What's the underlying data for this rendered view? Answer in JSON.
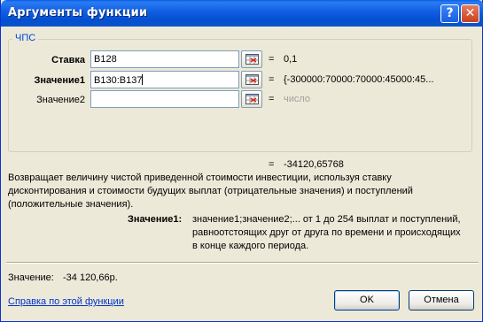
{
  "window": {
    "title": "Аргументы функции"
  },
  "titlebar_buttons": {
    "help": "?",
    "close": "✕"
  },
  "group": {
    "label": "ЧПС"
  },
  "args": [
    {
      "label": "Ставка",
      "value": "B128",
      "result": "0,1"
    },
    {
      "label": "Значение1",
      "value": "B130:B137",
      "result": "{-300000:70000:70000:45000:45..."
    },
    {
      "label": "Значение2",
      "value": "",
      "result": "число"
    }
  ],
  "equals": "=",
  "formula_result": "-34120,65768",
  "description": [
    "Возвращает величину чистой приведенной стоимости инвестиции, используя ставку",
    "дисконтирования и стоимости будущих выплат (отрицательные значения) и поступлений",
    "(положительные значения)."
  ],
  "arg_help": {
    "name": "Значение1:",
    "lines": [
      "значение1;значение2;... от 1 до 254 выплат и поступлений,",
      "равноотстоящих друг от друга по времени и происходящих",
      "в конце каждого периода."
    ]
  },
  "value_label": "Значение:",
  "value_text": "-34 120,66р.",
  "help_link": "Справка по этой функции",
  "ok_label": "OK",
  "cancel_label": "Отмена"
}
